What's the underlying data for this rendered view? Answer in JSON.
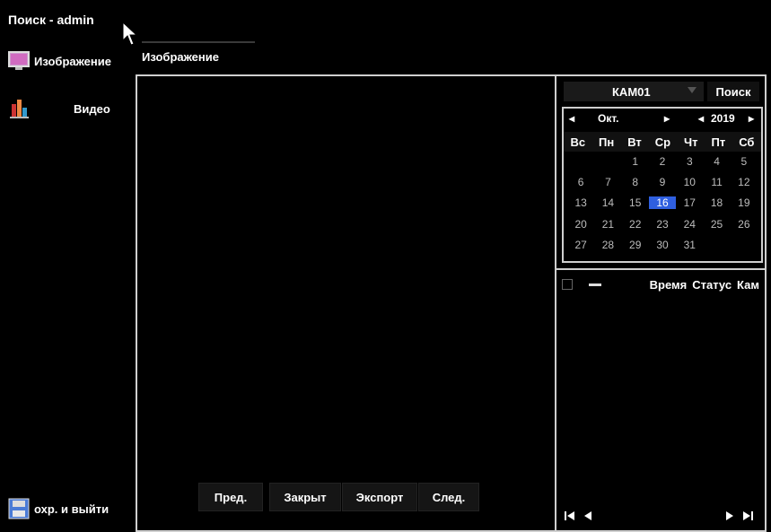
{
  "window": {
    "title": "Поиск - admin"
  },
  "tabs": {
    "active": "Изображение"
  },
  "sidebar": {
    "items": [
      {
        "label": "Изображение",
        "icon": "image-monitor-icon"
      },
      {
        "label": "Видео",
        "icon": "video-chart-icon"
      }
    ],
    "save_exit": {
      "label": "охр. и выйти",
      "icon": "save-disk-icon"
    }
  },
  "viewer": {
    "buttons": {
      "prev": "Пред.",
      "close": "Закрыт",
      "export": "Экспорт",
      "next": "След."
    }
  },
  "right": {
    "camera": {
      "selected": "КАМ01"
    },
    "search_label": "Поиск",
    "calendar": {
      "month_label": "Окт.",
      "year_label": "2019",
      "weekdays": [
        "Вс",
        "Пн",
        "Вт",
        "Ср",
        "Чт",
        "Пт",
        "Сб"
      ],
      "selected_day": "16",
      "days": [
        [
          "",
          "",
          "1",
          "2",
          "3",
          "4",
          "5"
        ],
        [
          "6",
          "7",
          "8",
          "9",
          "10",
          "11",
          "12"
        ],
        [
          "13",
          "14",
          "15",
          "16",
          "17",
          "18",
          "19"
        ],
        [
          "20",
          "21",
          "22",
          "23",
          "24",
          "25",
          "26"
        ],
        [
          "27",
          "28",
          "29",
          "30",
          "31",
          "",
          ""
        ]
      ]
    },
    "list": {
      "columns": [
        "Время",
        "Статус",
        "Кам"
      ]
    }
  }
}
